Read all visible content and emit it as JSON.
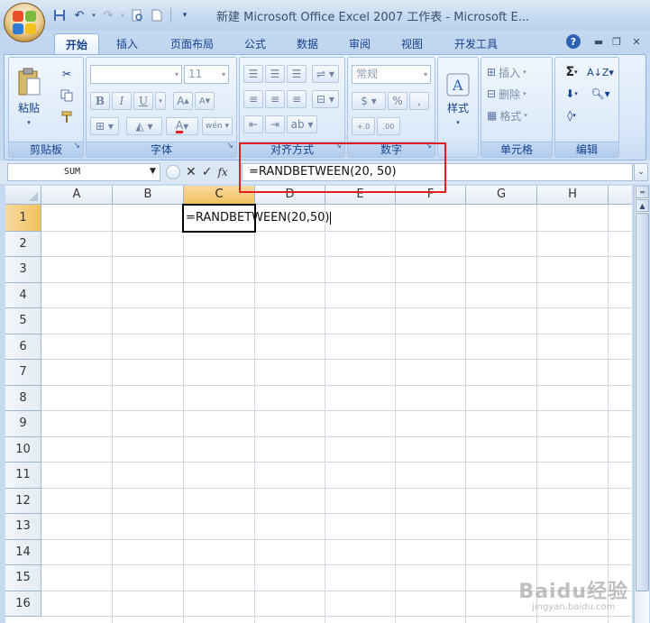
{
  "window": {
    "title": "新建 Microsoft Office Excel 2007 工作表 - Microsoft E..."
  },
  "qat": {
    "icons": [
      "save-icon",
      "undo-icon",
      "redo-icon",
      "print-preview-icon",
      "new-document-icon",
      "customize-qat-icon"
    ]
  },
  "tabs": [
    {
      "label": "开始",
      "active": true
    },
    {
      "label": "插入",
      "active": false
    },
    {
      "label": "页面布局",
      "active": false
    },
    {
      "label": "公式",
      "active": false
    },
    {
      "label": "数据",
      "active": false
    },
    {
      "label": "审阅",
      "active": false
    },
    {
      "label": "视图",
      "active": false
    },
    {
      "label": "开发工具",
      "active": false
    }
  ],
  "ribbon": {
    "clipboard": {
      "label": "剪贴板",
      "paste": "粘贴"
    },
    "font": {
      "label": "字体",
      "font_name": "",
      "font_size": "11",
      "bold": "B",
      "italic": "I",
      "underline": "U"
    },
    "alignment": {
      "label": "对齐方式"
    },
    "number": {
      "label": "数字",
      "format": "常规",
      "percent": "%",
      "comma": ","
    },
    "styles": {
      "label": "样式"
    },
    "cells": {
      "label": "单元格",
      "insert": "插入",
      "delete": "删除",
      "format": "格式"
    },
    "editing": {
      "label": "编辑"
    }
  },
  "formula_bar": {
    "name_box": "SUM",
    "formula": "=RANDBETWEEN(20, 50)",
    "fx": "fx"
  },
  "grid": {
    "columns": [
      "A",
      "B",
      "C",
      "D",
      "E",
      "F",
      "G",
      "H"
    ],
    "rows": [
      "1",
      "2",
      "3",
      "4",
      "5",
      "6",
      "7",
      "8",
      "9",
      "10",
      "11",
      "12",
      "13",
      "14",
      "15",
      "16"
    ],
    "selected_column": "C",
    "selected_row": "1",
    "active_cell_text": "=RANDBETWEEN(20,50)"
  },
  "colors": {
    "highlight": "#e02020",
    "selected_header": "#f1c15f"
  },
  "watermark": {
    "text": "Baidu经验",
    "sub": "jingyan.baidu.com"
  }
}
